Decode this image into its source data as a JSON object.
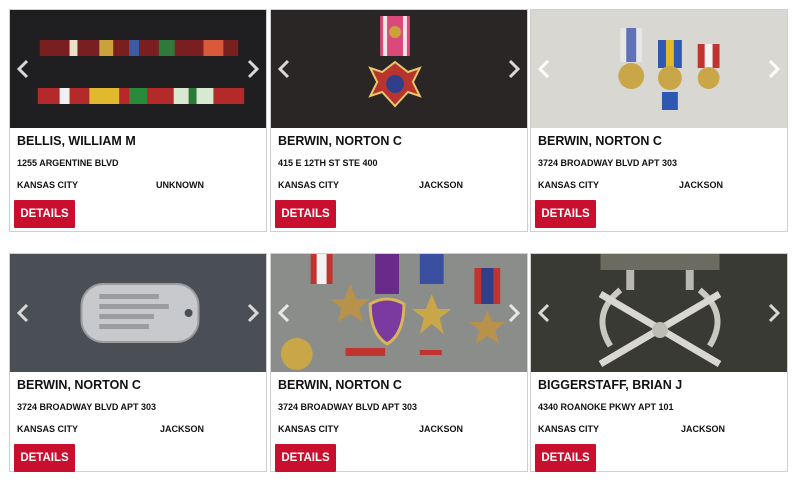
{
  "listings": [
    {
      "name": "BELLIS, WILLIAM M",
      "address": "1255 ARGENTINE BLVD",
      "city": "KANSAS CITY",
      "county": "UNKNOWN",
      "button": "DETAILS",
      "image": "ribbon-bars-photo"
    },
    {
      "name": "BERWIN, NORTON C",
      "address": "415 E 12TH ST STE 400",
      "city": "KANSAS CITY",
      "county": "JACKSON",
      "button": "DETAILS",
      "image": "legion-of-merit-medal-photo"
    },
    {
      "name": "BERWIN, NORTON C",
      "address": "3724 BROADWAY BLVD APT 303",
      "city": "KANSAS CITY",
      "county": "JACKSON",
      "button": "DETAILS",
      "image": "three-medals-photo"
    },
    {
      "name": "BERWIN, NORTON C",
      "address": "3724 BROADWAY BLVD APT 303",
      "city": "KANSAS CITY",
      "county": "JACKSON",
      "button": "DETAILS",
      "image": "dog-tag-photo"
    },
    {
      "name": "BERWIN, NORTON C",
      "address": "3724 BROADWAY BLVD APT 303",
      "city": "KANSAS CITY",
      "county": "JACKSON",
      "button": "DETAILS",
      "image": "medal-collection-photo"
    },
    {
      "name": "BIGGERSTAFF, BRIAN J",
      "address": "4340 ROANOKE PKWY APT 101",
      "city": "KANSAS CITY",
      "county": "JACKSON",
      "button": "DETAILS",
      "image": "crossed-rifles-insignia-photo"
    }
  ],
  "icons": {
    "prev": "chevron-left-icon",
    "next": "chevron-right-icon"
  },
  "colors": {
    "button": "#c8102e",
    "border": "#cfcfcf"
  }
}
